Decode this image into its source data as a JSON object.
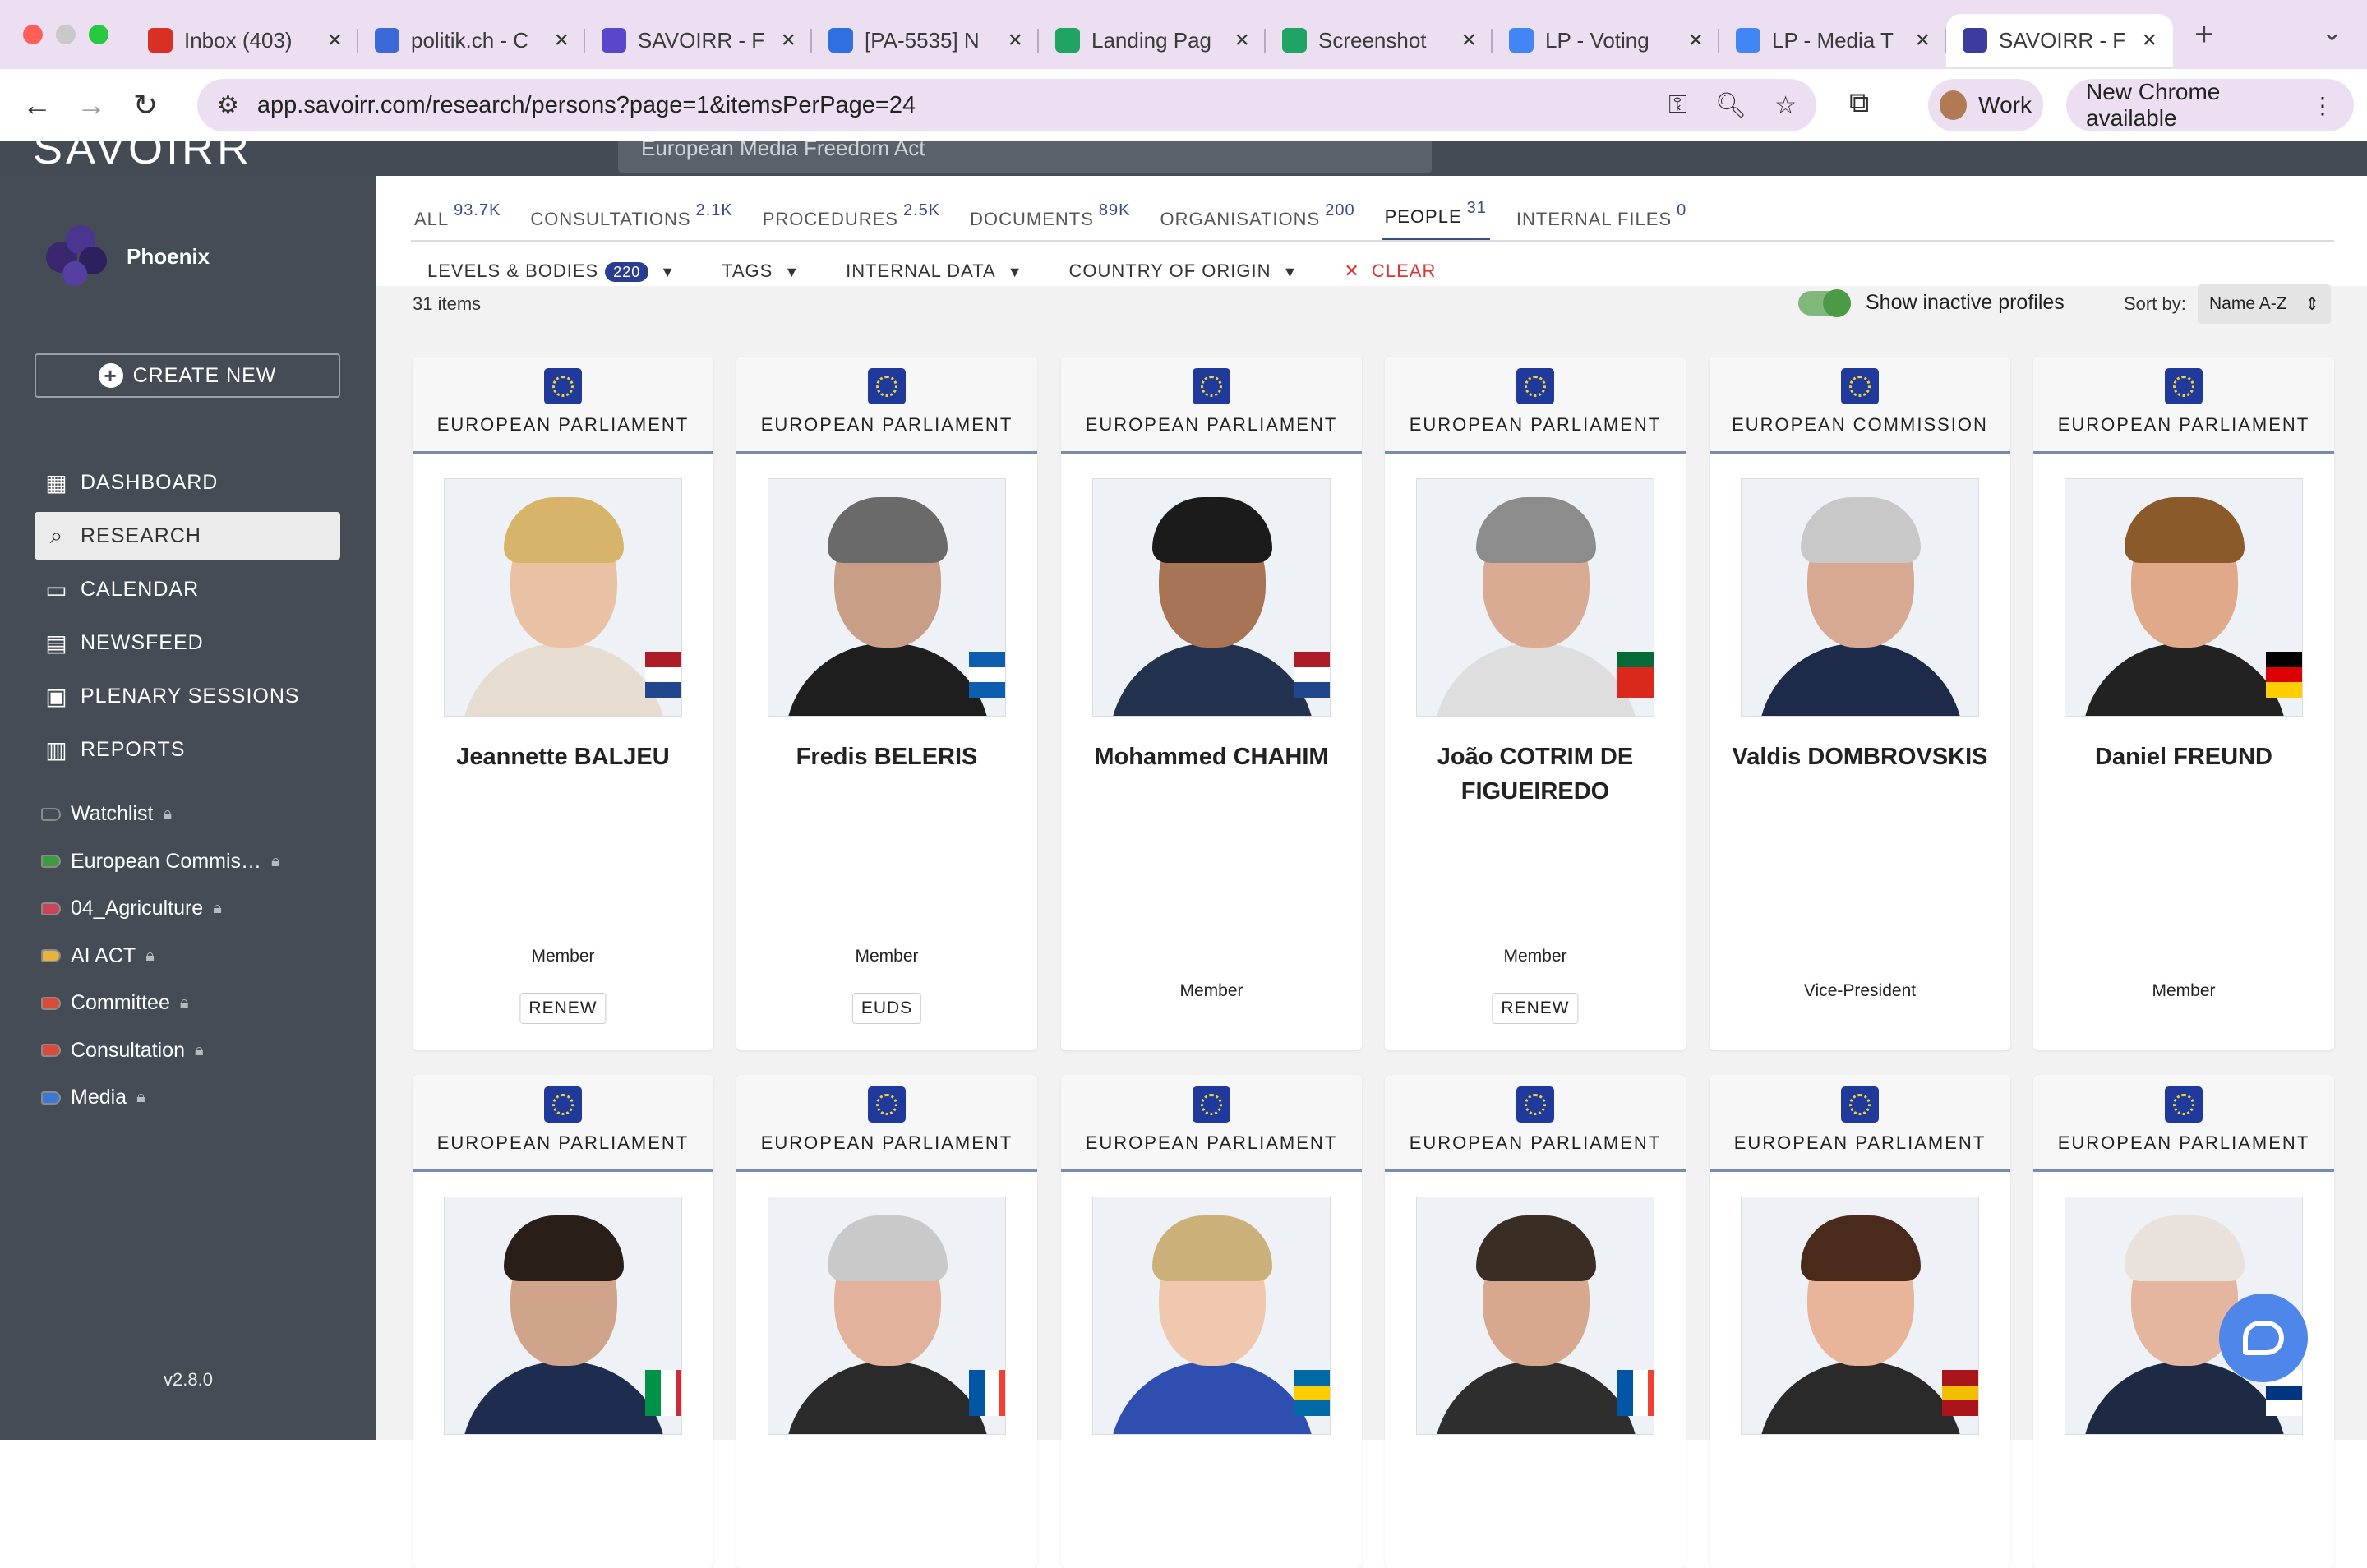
{
  "browser": {
    "tabs": [
      {
        "title": "Inbox (403)",
        "favicon": "gmail-icon",
        "color": "#d93025"
      },
      {
        "title": "politik.ch - C",
        "favicon": "calendar-icon",
        "color": "#3b6ad8"
      },
      {
        "title": "SAVOIRR - F",
        "favicon": "savoirr-icon",
        "color": "#5847c9"
      },
      {
        "title": "[PA-5535] N",
        "favicon": "jira-icon",
        "color": "#2f6fe0"
      },
      {
        "title": "Landing Pag",
        "favicon": "drive-icon",
        "color": "#1fa463"
      },
      {
        "title": "Screenshot",
        "favicon": "drive-icon",
        "color": "#1fa463"
      },
      {
        "title": "LP - Voting",
        "favicon": "docs-icon",
        "color": "#4285f4"
      },
      {
        "title": "LP - Media T",
        "favicon": "docs-icon",
        "color": "#4285f4"
      },
      {
        "title": "SAVOIRR - F",
        "favicon": "savoirr-icon",
        "color": "#3c3c9e"
      }
    ],
    "url": "app.savoirr.com/research/persons?page=1&itemsPerPage=24",
    "profile": "Work",
    "update_label": "New Chrome available"
  },
  "app": {
    "logo": "SAVOIRR",
    "search_value": "European Media Freedom Act"
  },
  "sidebar": {
    "workspace": "Phoenix",
    "create_label": "CREATE NEW",
    "nav": [
      "DASHBOARD",
      "RESEARCH",
      "CALENDAR",
      "NEWSFEED",
      "PLENARY SESSIONS",
      "REPORTS"
    ],
    "lists": [
      {
        "label": "Watchlist",
        "color": "#454c56"
      },
      {
        "label": "European Commis…",
        "color": "#3f9b3f"
      },
      {
        "label": "04_Agriculture",
        "color": "#c9435a"
      },
      {
        "label": "AI ACT",
        "color": "#e8b33a"
      },
      {
        "label": "Committee",
        "color": "#d94a3a"
      },
      {
        "label": "Consultation",
        "color": "#d94a3a"
      },
      {
        "label": "Media",
        "color": "#3a78d4"
      }
    ],
    "version": "v2.8.0"
  },
  "research": {
    "tabs": [
      {
        "label": "ALL",
        "count": "93.7K"
      },
      {
        "label": "CONSULTATIONS",
        "count": "2.1K"
      },
      {
        "label": "PROCEDURES",
        "count": "2.5K"
      },
      {
        "label": "DOCUMENTS",
        "count": "89K"
      },
      {
        "label": "ORGANISATIONS",
        "count": "200"
      },
      {
        "label": "PEOPLE",
        "count": "31"
      },
      {
        "label": "INTERNAL FILES",
        "count": "0"
      }
    ],
    "filters": {
      "levels": "LEVELS & BODIES",
      "levels_count": "220",
      "tags": "TAGS",
      "internal": "INTERNAL DATA",
      "country": "COUNTRY OF ORIGIN",
      "clear": "CLEAR"
    },
    "item_count": "31 items",
    "show_inactive": "Show inactive profiles",
    "sort_label": "Sort by:",
    "sort_value": "Name A-Z"
  },
  "people": [
    {
      "institution": "EUROPEAN PARLIAMENT",
      "name": "Jeannette BALJEU",
      "role": "Member",
      "group": "RENEW",
      "flag": [
        "#ae1c28",
        "#ffffff",
        "#21468b"
      ],
      "skin": "#e9c2a5",
      "hair": "#d8b46a",
      "suit": "#e7dcd0"
    },
    {
      "institution": "EUROPEAN PARLIAMENT",
      "name": "Fredis BELERIS",
      "role": "Member",
      "group": "EUDS",
      "flag": [
        "#0d5eaf",
        "#ffffff",
        "#0d5eaf"
      ],
      "skin": "#c89f86",
      "hair": "#6a6a6a",
      "suit": "#1e1e1e"
    },
    {
      "institution": "EUROPEAN PARLIAMENT",
      "name": "Mohammed CHAHIM",
      "role": "Member",
      "group": "",
      "flag": [
        "#ae1c28",
        "#ffffff",
        "#21468b"
      ],
      "skin": "#a87456",
      "hair": "#1b1b1b",
      "suit": "#23324f"
    },
    {
      "institution": "EUROPEAN PARLIAMENT",
      "name": "João COTRIM DE FIGUEIREDO",
      "role": "Member",
      "group": "RENEW",
      "flag": [
        "#046a38",
        "#da291c",
        "#da291c"
      ],
      "skin": "#d9ab92",
      "hair": "#8c8c8c",
      "suit": "#dedede"
    },
    {
      "institution": "EUROPEAN COMMISSION",
      "name": "Valdis DOMBROVSKIS",
      "role": "Vice-President",
      "group": "",
      "flag": [],
      "skin": "#d7a892",
      "hair": "#c8c8c8",
      "suit": "#1d2a4a"
    },
    {
      "institution": "EUROPEAN PARLIAMENT",
      "name": "Daniel FREUND",
      "role": "Member",
      "group": "",
      "flag": [
        "#000000",
        "#dd0000",
        "#ffce00"
      ],
      "skin": "#e0a98a",
      "hair": "#8a5a2a",
      "suit": "#222222"
    },
    {
      "institution": "EUROPEAN PARLIAMENT",
      "name": "",
      "role": "",
      "group": "",
      "flag": [
        "#009246",
        "#ffffff",
        "#ce2b37"
      ],
      "skin": "#d0a48a",
      "hair": "#2a1f18",
      "suit": "#1e2d4f"
    },
    {
      "institution": "EUROPEAN PARLIAMENT",
      "name": "",
      "role": "",
      "group": "",
      "flag": [
        "#0055a4",
        "#ffffff",
        "#ef4135"
      ],
      "skin": "#e2b29c",
      "hair": "#c9c9c9",
      "suit": "#2a2a2a"
    },
    {
      "institution": "EUROPEAN PARLIAMENT",
      "name": "",
      "role": "",
      "group": "",
      "flag": [
        "#006aa7",
        "#fecc00",
        "#006aa7"
      ],
      "skin": "#f0c8b0",
      "hair": "#cbb07a",
      "suit": "#2f4fb0"
    },
    {
      "institution": "EUROPEAN PARLIAMENT",
      "name": "",
      "role": "",
      "group": "",
      "flag": [
        "#0055a4",
        "#ffffff",
        "#ef4135"
      ],
      "skin": "#d8a88e",
      "hair": "#3a2e24",
      "suit": "#2e2e2e"
    },
    {
      "institution": "EUROPEAN PARLIAMENT",
      "name": "",
      "role": "",
      "group": "",
      "flag": [
        "#aa151b",
        "#f1bf00",
        "#aa151b"
      ],
      "skin": "#e8b49a",
      "hair": "#4a2a1a",
      "suit": "#2a2a2a"
    },
    {
      "institution": "EUROPEAN PARLIAMENT",
      "name": "",
      "role": "",
      "group": "",
      "flag": [
        "#ffffff",
        "#003580",
        "#ffffff"
      ],
      "skin": "#e4b6a0",
      "hair": "#e9e2dc",
      "suit": "#1e2a44"
    }
  ]
}
